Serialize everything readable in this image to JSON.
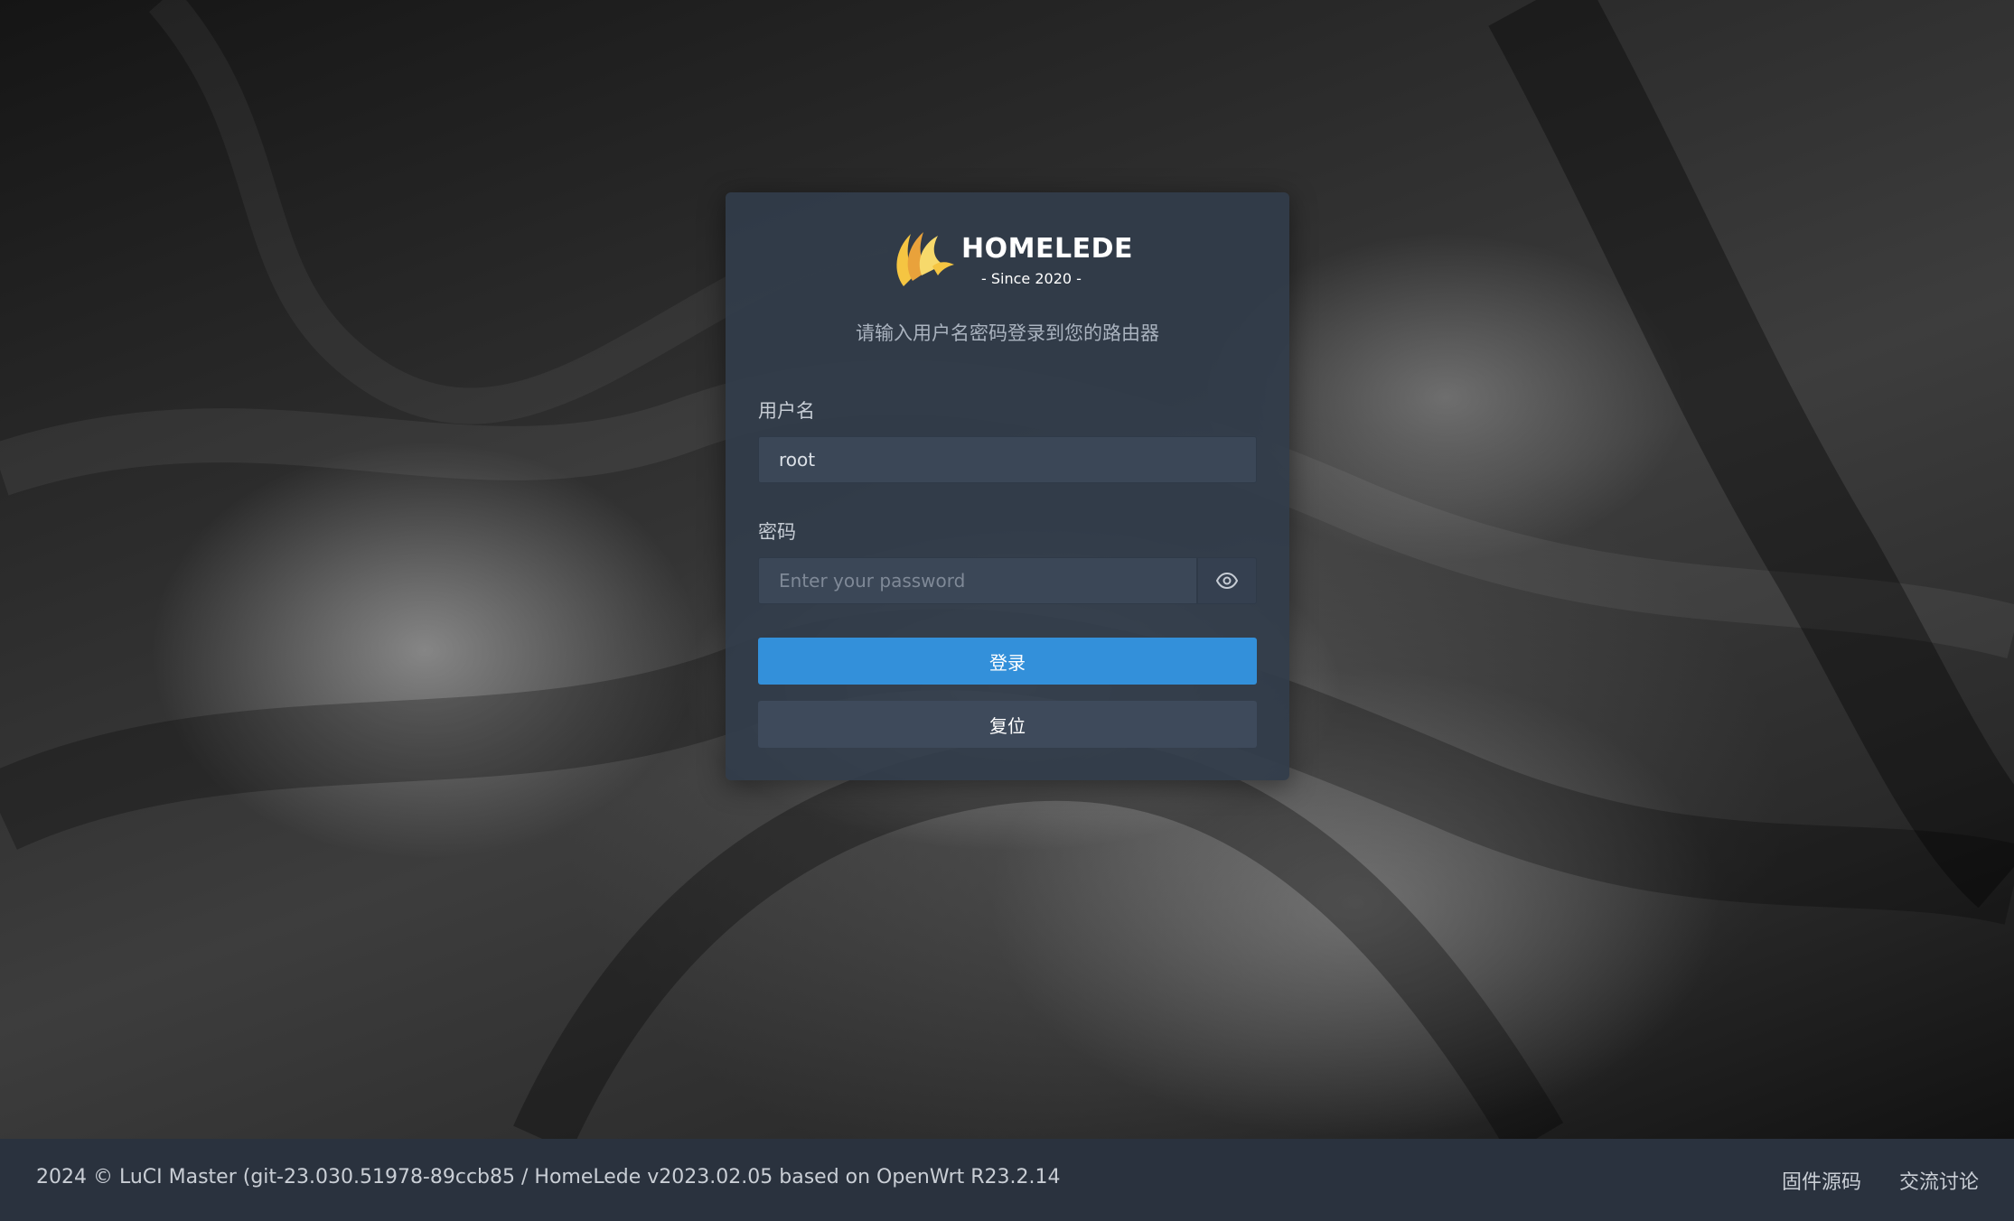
{
  "brand": {
    "name": "HOMELEDE",
    "tagline": "- Since 2020 -",
    "logo_colors": [
      "#f5c542",
      "#e9a23b",
      "#f7d96b"
    ]
  },
  "login": {
    "prompt": "请输入用户名密码登录到您的路由器",
    "username_label": "用户名",
    "username_value": "root",
    "password_label": "密码",
    "password_placeholder": "Enter your password",
    "toggle_icon": "eye-icon",
    "login_label": "登录",
    "reset_label": "复位",
    "accent_color": "#3390da"
  },
  "footer": {
    "copyright": "2024 © LuCI Master (git-23.030.51978-89ccb85 / HomeLede v2023.02.05 based on OpenWrt R23.2.14",
    "links": [
      "固件源码",
      "交流讨论"
    ]
  }
}
